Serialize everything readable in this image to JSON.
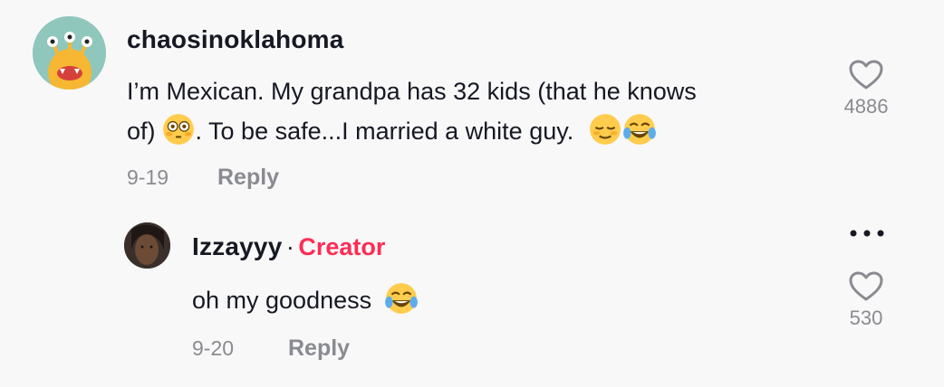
{
  "comment": {
    "username": "chaosinoklahoma",
    "text_line1": "I’m Mexican. My grandpa has 32 kids (that he knows",
    "text_line2_a": "of)",
    "text_line2_b": ". To be safe...I married a white guy.",
    "date": "9-19",
    "reply_label": "Reply",
    "likes": "4886",
    "avatar_icon": "monster-avatar",
    "emojis": [
      "flushed-face",
      "relieved-face",
      "tears-of-joy-face"
    ]
  },
  "reply": {
    "username": "Izzayyy",
    "separator": "·",
    "badge": "Creator",
    "text": "oh my goodness",
    "date": "9-20",
    "reply_label": "Reply",
    "likes": "530",
    "more_icon": "more-dots-icon",
    "emojis": [
      "tears-of-joy-face"
    ]
  },
  "colors": {
    "background": "#f8f8f8",
    "text": "#161823",
    "muted": "#8a8b91",
    "creator": "#fe2c55"
  }
}
